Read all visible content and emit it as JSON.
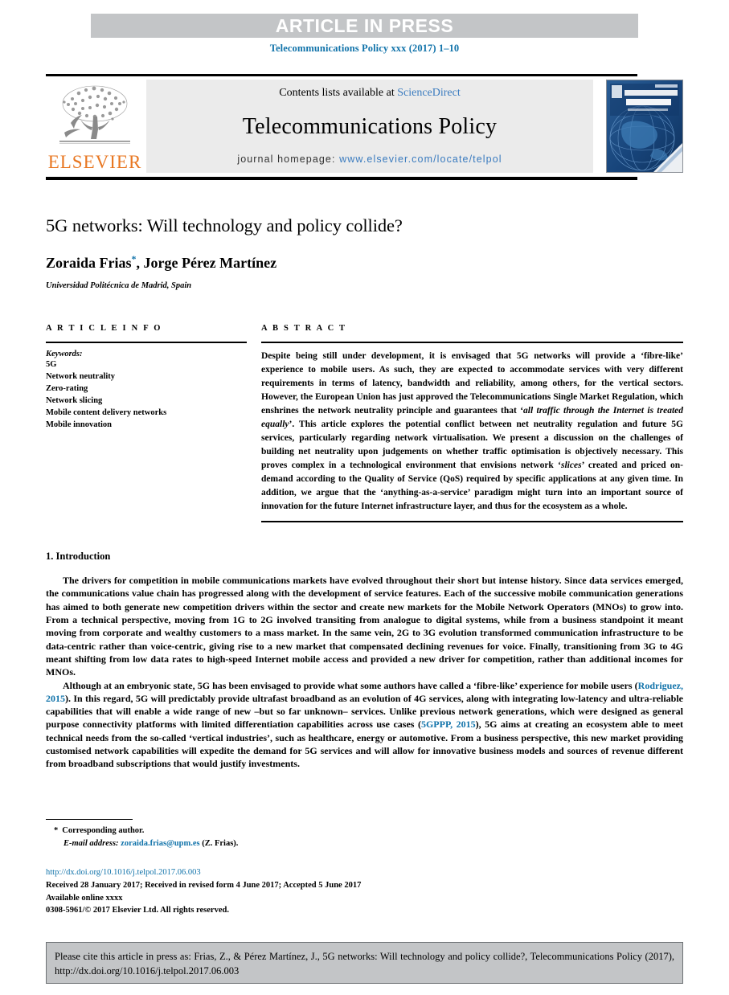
{
  "press_banner": {
    "text": "ARTICLE IN PRESS"
  },
  "running_head": {
    "text": "Telecommunications Policy xxx (2017) 1–10"
  },
  "masthead": {
    "contents_prefix": "Contents lists available at ",
    "contents_link": "ScienceDirect",
    "journal_name": "Telecommunications Policy",
    "homepage_prefix": "journal homepage: ",
    "homepage_url": "www.elsevier.com/locate/telpol",
    "publisher_logo_word": "ELSEVIER",
    "publisher_logo_icon": "elsevier-tree-icon",
    "cover_title_line1": "TELECOMMUNICATIONS",
    "cover_title_line2": "P O L I C Y",
    "cover_subtitle": "The International Journal of Telecommunications Policy"
  },
  "article": {
    "title": "5G networks: Will technology and policy collide?",
    "authors": "Zoraida Frias",
    "authors_rest": ", Jorge Pérez Martínez",
    "corresponding_marker": "*",
    "affiliation": "Universidad Politécnica de Madrid, Spain"
  },
  "article_info": {
    "label": "A R T I C L E  I N F O",
    "keywords_label": "Keywords:",
    "keywords": [
      "5G",
      "Network neutrality",
      "Zero-rating",
      "Network slicing",
      "Mobile content delivery networks",
      "Mobile innovation"
    ]
  },
  "abstract": {
    "label": "A B S T R A C T",
    "p1": "Despite being still under development, it is envisaged that 5G networks will provide a ‘fibre-like’ experience to mobile users. As such, they are expected to accommodate services with very different requirements in terms of latency, bandwidth and reliability, among others, for the vertical sectors. However, the European Union has just approved the Telecommunications Single Market Regulation, which enshrines the network neutrality principle and guarantees that ‘",
    "italic1": "all traffic through the Internet is treated equally",
    "p2": "’. This article explores the potential conflict between net neutrality regulation and future 5G services, particularly regarding network virtualisation. We present a discussion on the challenges of building net neutrality upon judgements on whether traffic optimisation is objectively necessary. This proves complex in a technological environment that envisions network ‘",
    "italic2": "slices",
    "p3": "’ created and priced on-demand according to the Quality of Service (QoS) required by specific applications at any given time. In addition, we argue that the ‘anything-as-a-service’ paradigm might turn into an important source of innovation for the future Internet infrastructure layer, and thus for the ecosystem as a whole."
  },
  "introduction": {
    "heading": "1.  Introduction",
    "para1": "The drivers for competition in mobile communications markets have evolved throughout their short but intense history. Since data services emerged, the communications value chain has progressed along with the development of service features. Each of the successive mobile communication generations has aimed to both generate new competition drivers within the sector and create new markets for the Mobile Network Operators (MNOs) to grow into. From a technical perspective, moving from 1G to 2G involved transiting from analogue to digital systems, while from a business standpoint it meant moving from corporate and wealthy customers to a mass market. In the same vein, 2G to 3G evolution transformed communication infrastructure to be data-centric rather than voice-centric, giving rise to a new market that compensated declining revenues for voice. Finally, transitioning from 3G to 4G meant shifting from low data rates to high-speed Internet mobile access and provided a new driver for competition, rather than additional incomes for MNOs.",
    "para2_a": "Although at an embryonic state, 5G has been envisaged to provide what some authors have called a ‘fibre-like’ experience for mobile users (",
    "citation1": "Rodriguez, 2015",
    "para2_b": "). In this regard, 5G will predictably provide ultrafast broadband as an evolution of 4G services, along with integrating low-latency and ultra-reliable capabilities that will enable a wide range of new –but so far unknown– services. Unlike previous network generations, which were designed as general purpose connectivity platforms with limited differentiation capabilities across use cases (",
    "citation2": "5GPPP, 2015",
    "para2_c": "), 5G aims at creating an ecosystem able to meet technical needs from the so-called ‘vertical industries’, such as healthcare, energy or automotive. From a business perspective, this new market providing customised network capabilities will expedite the demand for 5G services and will allow for innovative business models and sources of revenue different from broadband subscriptions that would justify investments."
  },
  "footnotes": {
    "corresponding_marker": "*",
    "corresponding_text": "Corresponding author.",
    "email_label": "E-mail address:",
    "email_value": "zoraida.frias@upm.es",
    "email_suffix": " (Z. Frias)."
  },
  "imprint": {
    "doi": "http://dx.doi.org/10.1016/j.telpol.2017.06.003",
    "dates": "Received 28 January 2017; Received in revised form 4 June 2017; Accepted 5 June 2017",
    "available": "Available online xxxx",
    "rights": "0308-5961/© 2017 Elsevier Ltd. All rights reserved."
  },
  "citation_box": {
    "text": "Please cite this article in press as: Frias, Z., & Pérez Martínez, J., 5G networks: Will technology and policy collide?, Telecommunications Policy (2017), http://dx.doi.org/10.1016/j.telpol.2017.06.003"
  },
  "colors": {
    "band_gray": "#c3c5c7",
    "link_blue": "#1173aa",
    "masthead_link_blue": "#3a7bbf",
    "elsevier_orange": "#e87722",
    "journal_box_gray": "#ebebeb",
    "cover_blue": "#1d4f86"
  }
}
